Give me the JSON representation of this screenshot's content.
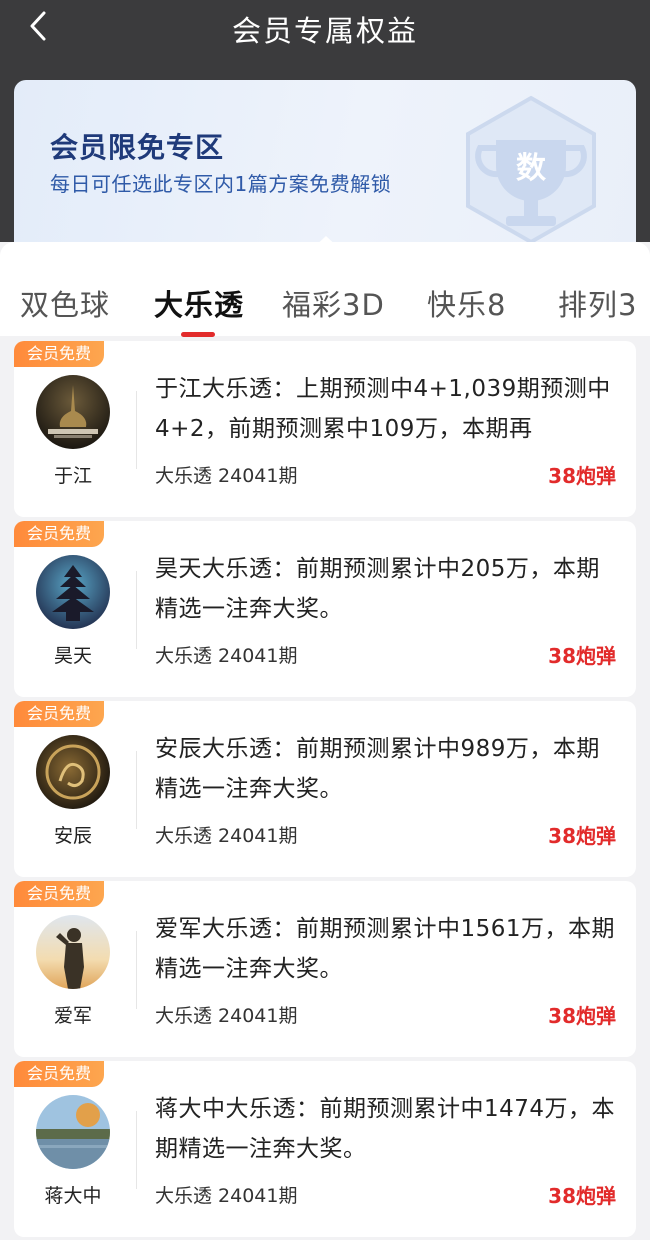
{
  "header": {
    "title": "会员专属权益",
    "back_icon": "chevron-left-icon"
  },
  "banner": {
    "title": "会员限免专区",
    "subtitle": "每日可任选此专区内1篇方案免费解锁",
    "trophy_char": "数"
  },
  "tabs": [
    {
      "label": "双色球",
      "active": false
    },
    {
      "label": "大乐透",
      "active": true
    },
    {
      "label": "福彩3D",
      "active": false
    },
    {
      "label": "快乐8",
      "active": false
    },
    {
      "label": "排列3",
      "active": false
    }
  ],
  "colors": {
    "accent": "#e22b2b",
    "badge": "#ff8a3a",
    "header_bg": "#3b3b3d",
    "banner_title": "#1f3a7a"
  },
  "items": [
    {
      "badge": "会员免费",
      "author": "于江",
      "desc": "于江大乐透：上期预测中4+1,039期预测中4+2，前期预测累中109万，本期再",
      "meta": "大乐透 24041期",
      "price": "38炮弹"
    },
    {
      "badge": "会员免费",
      "author": "昊天",
      "desc": "昊天大乐透：前期预测累计中205万，本期精选一注奔大奖。",
      "meta": "大乐透 24041期",
      "price": "38炮弹"
    },
    {
      "badge": "会员免费",
      "author": "安辰",
      "desc": "安辰大乐透：前期预测累计中989万，本期精选一注奔大奖。",
      "meta": "大乐透 24041期",
      "price": "38炮弹"
    },
    {
      "badge": "会员免费",
      "author": "爱军",
      "desc": "爱军大乐透：前期预测累计中1561万，本期精选一注奔大奖。",
      "meta": "大乐透 24041期",
      "price": "38炮弹"
    },
    {
      "badge": "会员免费",
      "author": "蒋大中",
      "desc": "蒋大中大乐透：前期预测累计中1474万，本期精选一注奔大奖。",
      "meta": "大乐透 24041期",
      "price": "38炮弹"
    }
  ]
}
